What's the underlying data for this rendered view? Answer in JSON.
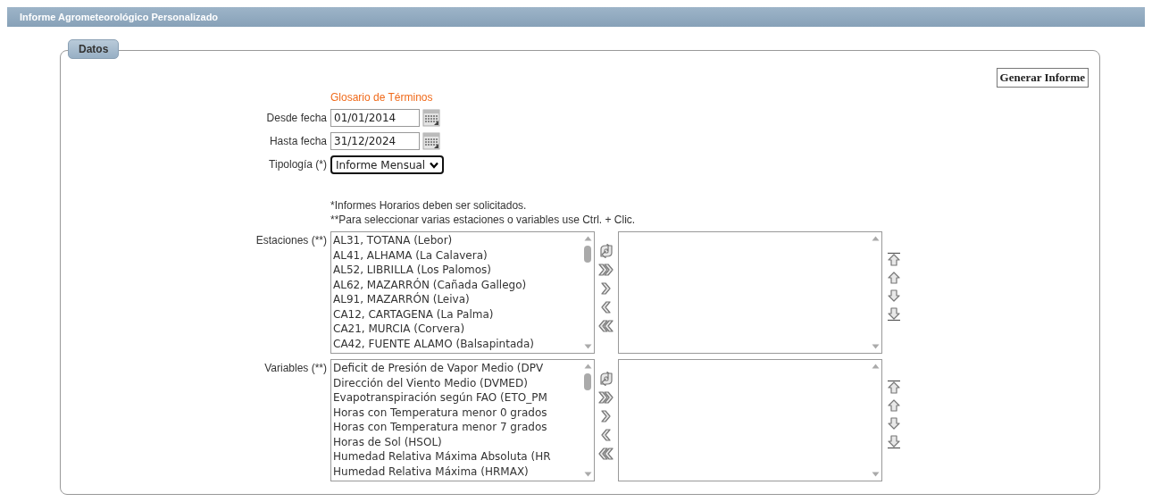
{
  "window": {
    "title": "Informe Agrometeorológico Personalizado"
  },
  "tab": {
    "label": "Datos"
  },
  "generate_button": {
    "label": "Generar Informe"
  },
  "glossary_link": "Glosario de Términos",
  "fields": [
    {
      "kind": "date",
      "label": "Desde fecha",
      "value": "01/01/2014"
    },
    {
      "kind": "date",
      "label": "Hasta fecha",
      "value": "31/12/2024"
    },
    {
      "kind": "select",
      "label": "Tipología (*)",
      "value": "Informe Mensual"
    }
  ],
  "notes": [
    "*Informes Horarios deben ser solicitados.",
    "**Para seleccionar varias estaciones o variables use Ctrl. + Clic."
  ],
  "pickers": [
    {
      "label": "Estaciones (**)",
      "available": [
        "AL31, TOTANA (Lebor)",
        "AL41, ALHAMA (La Calavera)",
        "AL52, LIBRILLA (Los Palomos)",
        "AL62, MAZARRÓN (Cañada Gallego)",
        "AL91, MAZARRÓN (Leiva)",
        "CA12, CARTAGENA (La Palma)",
        "CA21, MURCIA (Corvera)",
        "CA42, FUENTE ALAMO (Balsapintada)"
      ]
    },
    {
      "label": "Variables (**)",
      "available": [
        "Deficit de Presión de Vapor Medio (DPV",
        "Dirección del Viento Medio (DVMED)",
        "Evapotranspiración según FAO (ETO_PM",
        "Horas con Temperatura menor 0 grados",
        "Horas con Temperatura menor 7 grados",
        "Horas de Sol (HSOL)",
        "Humedad Relativa Máxima Absoluta (HR",
        "Humedad Relativa Máxima (HRMAX)"
      ]
    }
  ]
}
